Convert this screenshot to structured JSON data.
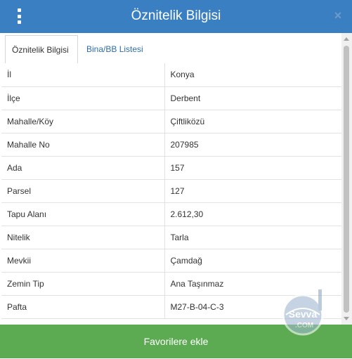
{
  "header": {
    "title": "Öznitelik Bilgisi",
    "menu_icon": "vertical-ellipsis-icon",
    "close_icon": "close-icon",
    "close_glyph": "×"
  },
  "tabs": [
    {
      "label": "Öznitelik Bilgisi",
      "active": true
    },
    {
      "label": "Bina/BB Listesi",
      "active": false
    }
  ],
  "attributes": [
    {
      "key": "İl",
      "value": "Konya"
    },
    {
      "key": "İlçe",
      "value": "Derbent"
    },
    {
      "key": "Mahalle/Köy",
      "value": "Çiftliközü"
    },
    {
      "key": "Mahalle No",
      "value": "207985"
    },
    {
      "key": "Ada",
      "value": "157"
    },
    {
      "key": "Parsel",
      "value": "127"
    },
    {
      "key": "Tapu Alanı",
      "value": "2.612,30"
    },
    {
      "key": "Nitelik",
      "value": "Tarla"
    },
    {
      "key": "Mevkii",
      "value": "Çamdağ"
    },
    {
      "key": "Zemin Tip",
      "value": "Ana Taşınmaz"
    },
    {
      "key": "Pafta",
      "value": "M27-B-04-C-3"
    }
  ],
  "footer": {
    "favorite_button": "Favorilere ekle"
  },
  "watermark": {
    "text_top": "Sevva",
    "text_bottom": ".COM"
  },
  "colors": {
    "header_bg": "#3a7fc2",
    "tab_link": "#2f6ea8",
    "favorite_bg": "#5cab52"
  }
}
